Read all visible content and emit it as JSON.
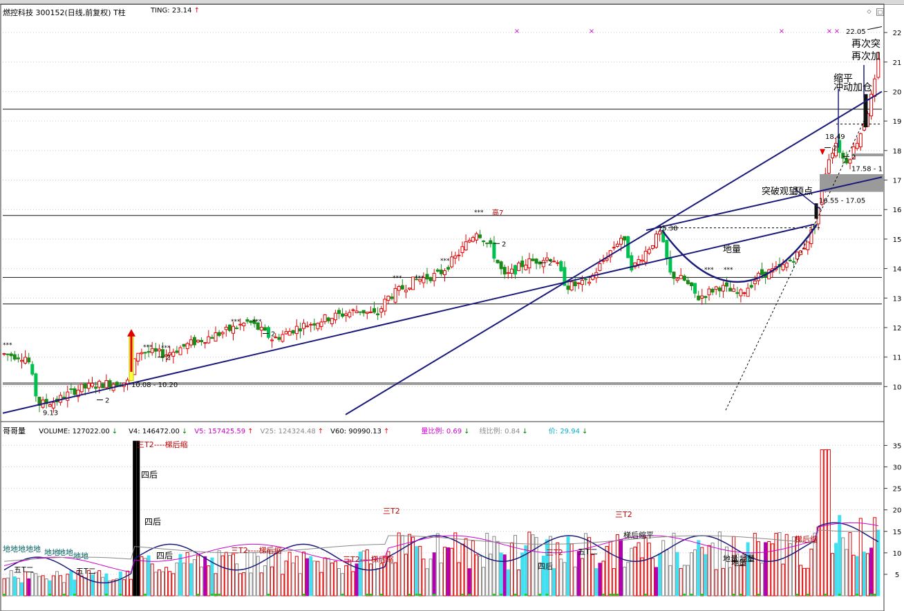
{
  "header": {
    "title": "燃控科技 300152(日线,前复权) T柱",
    "ting_label": "TING: 23.14",
    "ting_arrow": "↑"
  },
  "volume_header": {
    "name": "哥哥量",
    "items": [
      {
        "text": "VOLUME: 127022.00",
        "arrow": "↓",
        "color": "#000000",
        "arrow_color": "#008000"
      },
      {
        "text": "V4: 146472.00",
        "arrow": "↓",
        "color": "#000000",
        "arrow_color": "#008000"
      },
      {
        "text": "V5: 157425.59",
        "arrow": "↑",
        "color": "#cc00cc",
        "arrow_color": "#e00000"
      },
      {
        "text": "V25: 124324.48",
        "arrow": "↑",
        "color": "#888888",
        "arrow_color": "#e00000"
      },
      {
        "text": "V60: 90990.13",
        "arrow": "↑",
        "color": "#000000",
        "arrow_color": "#e00000"
      },
      {
        "text": "量比例: 0.69",
        "arrow": "↓",
        "color": "#cc00cc",
        "arrow_color": "#008000"
      },
      {
        "text": "线比例: 0.84",
        "arrow": "↓",
        "color": "#888888",
        "arrow_color": "#008000"
      },
      {
        "text": "价: 29.94",
        "arrow": "↓",
        "color": "#00b0d0",
        "arrow_color": "#008000"
      }
    ]
  },
  "colors": {
    "up": "#e00000",
    "down": "#00c050",
    "trendline": "#1a1a7a",
    "cyan_bar": "#40e0f0",
    "magenta_bar": "#b000b0",
    "grey_band": "#9a9a9a"
  },
  "chart_data": [
    {
      "type": "candlestick",
      "title": "燃控科技 300152(日线,前复权) T柱",
      "y_axis_ticks": [
        "22",
        "21",
        "20",
        "19",
        "18",
        "17",
        "16",
        "15",
        "14",
        "13",
        "12",
        "11",
        "10"
      ],
      "ylim": [
        9.0,
        22.4
      ],
      "horizontal_levels": [
        19.4,
        15.8,
        13.7,
        12.8,
        10.1
      ],
      "price_labels": [
        {
          "text": "22.05",
          "value": 22.05
        },
        {
          "text": "18.49",
          "value": 18.49
        },
        {
          "text": "17.58 - 1",
          "value": 17.58
        },
        {
          "text": "16.55 - 17.05",
          "value": 16.55
        },
        {
          "text": "15.38",
          "value": 15.38
        },
        {
          "text": "10.08 - 10.20",
          "value": 10.08
        },
        {
          "text": "9.13",
          "value": 9.13
        }
      ],
      "markers": [
        "2",
        "2",
        "2",
        "2",
        "2",
        "2",
        "2"
      ],
      "annotations": [
        "再次突",
        "再次加",
        "缩平",
        "冲动加仓",
        "突破观望",
        "顶点",
        "地量",
        "高7",
        "***"
      ]
    },
    {
      "type": "bar",
      "title": "哥哥量",
      "y_axis_ticks": [
        "35",
        "30",
        "25",
        "20",
        "15",
        "10",
        "5"
      ],
      "ylim": [
        0,
        37
      ],
      "annotations": [
        "三T2----梯后缩",
        "四后",
        "四后",
        "四后",
        "三T2----梯后缩",
        "三T2----梯后缩",
        "三T2",
        "三T2",
        "三T2",
        "梯后缩平",
        "梯后缩",
        "地量",
        "地量",
        "地量",
        "五T二",
        "五T二",
        "四后",
        "五T二",
        "地地地地地",
        "地地",
        "地地",
        "地地"
      ]
    }
  ]
}
